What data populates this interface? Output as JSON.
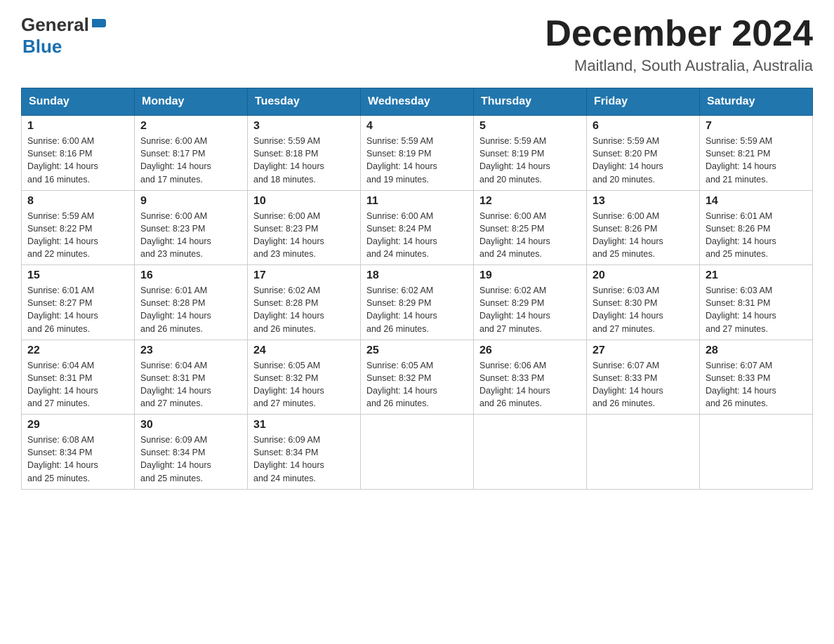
{
  "header": {
    "logo": {
      "general": "General",
      "blue": "Blue"
    },
    "title": "December 2024",
    "location": "Maitland, South Australia, Australia"
  },
  "weekdays": [
    "Sunday",
    "Monday",
    "Tuesday",
    "Wednesday",
    "Thursday",
    "Friday",
    "Saturday"
  ],
  "weeks": [
    [
      {
        "day": "1",
        "sunrise": "6:00 AM",
        "sunset": "8:16 PM",
        "daylight": "14 hours and 16 minutes."
      },
      {
        "day": "2",
        "sunrise": "6:00 AM",
        "sunset": "8:17 PM",
        "daylight": "14 hours and 17 minutes."
      },
      {
        "day": "3",
        "sunrise": "5:59 AM",
        "sunset": "8:18 PM",
        "daylight": "14 hours and 18 minutes."
      },
      {
        "day": "4",
        "sunrise": "5:59 AM",
        "sunset": "8:19 PM",
        "daylight": "14 hours and 19 minutes."
      },
      {
        "day": "5",
        "sunrise": "5:59 AM",
        "sunset": "8:19 PM",
        "daylight": "14 hours and 20 minutes."
      },
      {
        "day": "6",
        "sunrise": "5:59 AM",
        "sunset": "8:20 PM",
        "daylight": "14 hours and 20 minutes."
      },
      {
        "day": "7",
        "sunrise": "5:59 AM",
        "sunset": "8:21 PM",
        "daylight": "14 hours and 21 minutes."
      }
    ],
    [
      {
        "day": "8",
        "sunrise": "5:59 AM",
        "sunset": "8:22 PM",
        "daylight": "14 hours and 22 minutes."
      },
      {
        "day": "9",
        "sunrise": "6:00 AM",
        "sunset": "8:23 PM",
        "daylight": "14 hours and 23 minutes."
      },
      {
        "day": "10",
        "sunrise": "6:00 AM",
        "sunset": "8:23 PM",
        "daylight": "14 hours and 23 minutes."
      },
      {
        "day": "11",
        "sunrise": "6:00 AM",
        "sunset": "8:24 PM",
        "daylight": "14 hours and 24 minutes."
      },
      {
        "day": "12",
        "sunrise": "6:00 AM",
        "sunset": "8:25 PM",
        "daylight": "14 hours and 24 minutes."
      },
      {
        "day": "13",
        "sunrise": "6:00 AM",
        "sunset": "8:26 PM",
        "daylight": "14 hours and 25 minutes."
      },
      {
        "day": "14",
        "sunrise": "6:01 AM",
        "sunset": "8:26 PM",
        "daylight": "14 hours and 25 minutes."
      }
    ],
    [
      {
        "day": "15",
        "sunrise": "6:01 AM",
        "sunset": "8:27 PM",
        "daylight": "14 hours and 26 minutes."
      },
      {
        "day": "16",
        "sunrise": "6:01 AM",
        "sunset": "8:28 PM",
        "daylight": "14 hours and 26 minutes."
      },
      {
        "day": "17",
        "sunrise": "6:02 AM",
        "sunset": "8:28 PM",
        "daylight": "14 hours and 26 minutes."
      },
      {
        "day": "18",
        "sunrise": "6:02 AM",
        "sunset": "8:29 PM",
        "daylight": "14 hours and 26 minutes."
      },
      {
        "day": "19",
        "sunrise": "6:02 AM",
        "sunset": "8:29 PM",
        "daylight": "14 hours and 27 minutes."
      },
      {
        "day": "20",
        "sunrise": "6:03 AM",
        "sunset": "8:30 PM",
        "daylight": "14 hours and 27 minutes."
      },
      {
        "day": "21",
        "sunrise": "6:03 AM",
        "sunset": "8:31 PM",
        "daylight": "14 hours and 27 minutes."
      }
    ],
    [
      {
        "day": "22",
        "sunrise": "6:04 AM",
        "sunset": "8:31 PM",
        "daylight": "14 hours and 27 minutes."
      },
      {
        "day": "23",
        "sunrise": "6:04 AM",
        "sunset": "8:31 PM",
        "daylight": "14 hours and 27 minutes."
      },
      {
        "day": "24",
        "sunrise": "6:05 AM",
        "sunset": "8:32 PM",
        "daylight": "14 hours and 27 minutes."
      },
      {
        "day": "25",
        "sunrise": "6:05 AM",
        "sunset": "8:32 PM",
        "daylight": "14 hours and 26 minutes."
      },
      {
        "day": "26",
        "sunrise": "6:06 AM",
        "sunset": "8:33 PM",
        "daylight": "14 hours and 26 minutes."
      },
      {
        "day": "27",
        "sunrise": "6:07 AM",
        "sunset": "8:33 PM",
        "daylight": "14 hours and 26 minutes."
      },
      {
        "day": "28",
        "sunrise": "6:07 AM",
        "sunset": "8:33 PM",
        "daylight": "14 hours and 26 minutes."
      }
    ],
    [
      {
        "day": "29",
        "sunrise": "6:08 AM",
        "sunset": "8:34 PM",
        "daylight": "14 hours and 25 minutes."
      },
      {
        "day": "30",
        "sunrise": "6:09 AM",
        "sunset": "8:34 PM",
        "daylight": "14 hours and 25 minutes."
      },
      {
        "day": "31",
        "sunrise": "6:09 AM",
        "sunset": "8:34 PM",
        "daylight": "14 hours and 24 minutes."
      },
      null,
      null,
      null,
      null
    ]
  ],
  "labels": {
    "sunrise": "Sunrise:",
    "sunset": "Sunset:",
    "daylight": "Daylight:"
  }
}
